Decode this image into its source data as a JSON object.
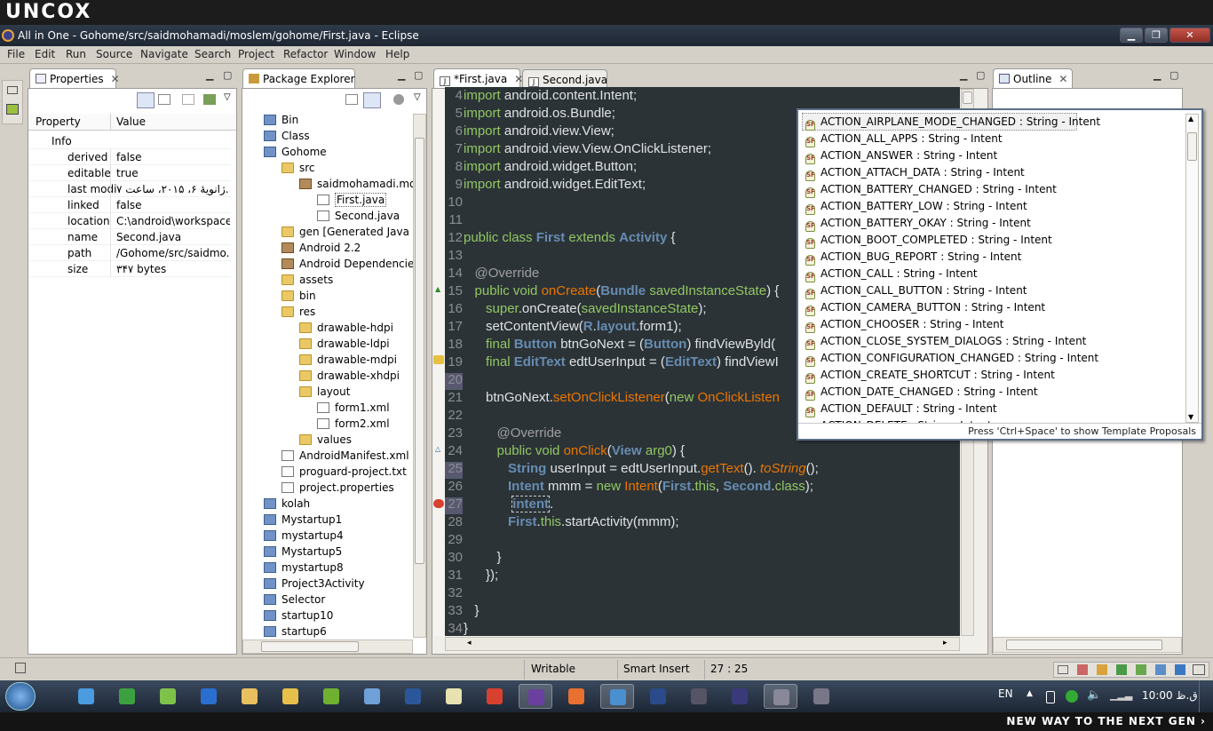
{
  "brand": "UNCOX",
  "window": {
    "title": "All in One - Gohome/src/saidmohamadi/moslem/gohome/First.java - Eclipse",
    "buttons": {
      "minimize": "▁",
      "maximize": "❐",
      "close": "✕"
    }
  },
  "menu": [
    "File",
    "Edit",
    "Run",
    "Source",
    "Navigate",
    "Search",
    "Project",
    "Refactor",
    "Window",
    "Help"
  ],
  "properties": {
    "tab": "Properties",
    "columns": [
      "Property",
      "Value"
    ],
    "group": "Info",
    "rows": [
      {
        "name": "derived",
        "value": "false"
      },
      {
        "name": "editable",
        "value": "true"
      },
      {
        "name": "last modi",
        "value": "ژانویهٔ ۶، ۲۰۱۵، ساعت ۷..."
      },
      {
        "name": "linked",
        "value": "false"
      },
      {
        "name": "location",
        "value": "C:\\android\\workspace..."
      },
      {
        "name": "name",
        "value": "Second.java"
      },
      {
        "name": "path",
        "value": "/Gohome/src/saidmo..."
      },
      {
        "name": "size",
        "value": "۳۴۷  bytes"
      }
    ]
  },
  "package_explorer": {
    "tab": "Package Explorer",
    "items": [
      {
        "label": "Bin",
        "icon": "project-icon",
        "indent": 0
      },
      {
        "label": "Class",
        "icon": "project-icon",
        "indent": 0
      },
      {
        "label": "Gohome",
        "icon": "android-project-icon",
        "indent": 0
      },
      {
        "label": "src",
        "icon": "source-folder-icon",
        "indent": 1
      },
      {
        "label": "saidmohamadi.mosl",
        "icon": "package-icon",
        "indent": 2
      },
      {
        "label": "First.java",
        "icon": "java-file-icon",
        "indent": 3,
        "selected": true
      },
      {
        "label": "Second.java",
        "icon": "java-file-icon",
        "indent": 3
      },
      {
        "label": "gen [Generated Java File",
        "icon": "source-folder-icon",
        "indent": 1
      },
      {
        "label": "Android 2.2",
        "icon": "library-icon",
        "indent": 1
      },
      {
        "label": "Android Dependencies",
        "icon": "library-icon",
        "indent": 1
      },
      {
        "label": "assets",
        "icon": "folder-icon",
        "indent": 1
      },
      {
        "label": "bin",
        "icon": "folder-icon",
        "indent": 1
      },
      {
        "label": "res",
        "icon": "folder-icon",
        "indent": 1
      },
      {
        "label": "drawable-hdpi",
        "icon": "folder-icon",
        "indent": 2
      },
      {
        "label": "drawable-ldpi",
        "icon": "folder-icon",
        "indent": 2
      },
      {
        "label": "drawable-mdpi",
        "icon": "folder-icon",
        "indent": 2
      },
      {
        "label": "drawable-xhdpi",
        "icon": "folder-icon",
        "indent": 2
      },
      {
        "label": "layout",
        "icon": "folder-icon",
        "indent": 2
      },
      {
        "label": "form1.xml",
        "icon": "xml-file-icon",
        "indent": 3
      },
      {
        "label": "form2.xml",
        "icon": "xml-file-icon",
        "indent": 3
      },
      {
        "label": "values",
        "icon": "folder-icon",
        "indent": 2
      },
      {
        "label": "AndroidManifest.xml",
        "icon": "xml-file-icon",
        "indent": 1
      },
      {
        "label": "proguard-project.txt",
        "icon": "text-file-icon",
        "indent": 1
      },
      {
        "label": "project.properties",
        "icon": "text-file-icon",
        "indent": 1
      },
      {
        "label": "kolah",
        "icon": "project-icon",
        "indent": 0
      },
      {
        "label": "Mystartup1",
        "icon": "project-icon",
        "indent": 0
      },
      {
        "label": "mystartup4",
        "icon": "project-icon",
        "indent": 0
      },
      {
        "label": "Mystartup5",
        "icon": "project-icon",
        "indent": 0
      },
      {
        "label": "mystartup8",
        "icon": "project-icon",
        "indent": 0
      },
      {
        "label": "Project3Activity",
        "icon": "project-icon",
        "indent": 0
      },
      {
        "label": "Selector",
        "icon": "project-icon",
        "indent": 0
      },
      {
        "label": "startup10",
        "icon": "project-icon",
        "indent": 0
      },
      {
        "label": "startup6",
        "icon": "project-icon",
        "indent": 0
      }
    ]
  },
  "editor": {
    "tabs": [
      {
        "label": "*First.java",
        "active": true
      },
      {
        "label": "Second.java",
        "active": false
      }
    ],
    "lines": [
      {
        "n": "4",
        "html": "<span class='kw'>import</span> android.content.Intent;"
      },
      {
        "n": "5",
        "html": "<span class='kw'>import</span> android.os.Bundle;"
      },
      {
        "n": "6",
        "html": "<span class='kw'>import</span> android.view.View;"
      },
      {
        "n": "7",
        "html": "<span class='kw'>import</span> android.view.View.OnClickListener;"
      },
      {
        "n": "8",
        "html": "<span class='kw'>import</span> android.widget.Button;"
      },
      {
        "n": "9",
        "html": "<span class='kw'>import</span> android.widget.EditText;"
      },
      {
        "n": "10",
        "html": ""
      },
      {
        "n": "11",
        "html": ""
      },
      {
        "n": "12",
        "html": "<span class='kw'>public class</span> <span class='typb'>First</span> <span class='kw'>extends</span> <span class='typb'>Activity</span> {"
      },
      {
        "n": "13",
        "html": ""
      },
      {
        "n": "14",
        "html": "   <span class='ann'>@Override</span>"
      },
      {
        "n": "15",
        "html": "   <span class='kw'>public void</span> <span class='str'>onCreate</span>(<span class='typb'>Bundle</span> <span class='kw'>savedInstanceState</span>) {"
      },
      {
        "n": "16",
        "html": "      <span class='kw'>super</span>.onCreate(<span class='kw'>savedInstanceState</span>);"
      },
      {
        "n": "17",
        "html": "      setContentView(<span class='typb'>R</span>.<span class='typb'>layout</span>.form1);"
      },
      {
        "n": "18",
        "html": "      <span class='kw'>final</span> <span class='typb'>Button</span> btnGoNext = (<span class='typb'>Button</span>) findViewByld("
      },
      {
        "n": "19",
        "html": "      <span class='kw'>final</span> <span class='typb'>EditText</span> edtUserInput = (<span class='typb'>EditText</span>) findViewI"
      },
      {
        "n": "20",
        "html": ""
      },
      {
        "n": "21",
        "html": "      btnGoNext.<span class='str'>setOnClickListener</span>(<span class='kw'>new</span> <span class='str'>OnClickListen</span>"
      },
      {
        "n": "22",
        "html": ""
      },
      {
        "n": "23",
        "html": "         <span class='ann'>@Override</span>"
      },
      {
        "n": "24",
        "html": "         <span class='kw'>public void</span> <span class='str'>onClick</span>(<span class='typb'>View</span> <span class='kw'>arg0</span>) {"
      },
      {
        "n": "25",
        "html": "            <span class='typb'>String</span> userInput = edtUserInput.<span class='str'>getText</span>(). <span class='it'>toString</span>();"
      },
      {
        "n": "26",
        "html": "            <span class='typb'>Intent</span> mmm = <span class='kw'>new</span> <span class='str'>Intent</span>(<span class='typb'>First</span>.<span class='kw'>this</span>, <span class='typb'>Second</span>.<span class='kw'>class</span>);"
      },
      {
        "n": "27",
        "html": "             <span class='typb' style='border:1px dashed #ccc'>intent</span>."
      },
      {
        "n": "28",
        "html": "            <span class='typb'>First</span>.<span class='kw'>this</span>.startActivity(mmm);"
      },
      {
        "n": "29",
        "html": ""
      },
      {
        "n": "30",
        "html": "         }"
      },
      {
        "n": "31",
        "html": "      });"
      },
      {
        "n": "32",
        "html": ""
      },
      {
        "n": "33",
        "html": "   }"
      },
      {
        "n": "34",
        "html": "}"
      }
    ]
  },
  "outline": {
    "tab": "Outline"
  },
  "content_assist": {
    "proposals": [
      "ACTION_AIRPLANE_MODE_CHANGED : String - Intent",
      "ACTION_ALL_APPS : String - Intent",
      "ACTION_ANSWER : String - Intent",
      "ACTION_ATTACH_DATA : String - Intent",
      "ACTION_BATTERY_CHANGED : String - Intent",
      "ACTION_BATTERY_LOW : String - Intent",
      "ACTION_BATTERY_OKAY : String - Intent",
      "ACTION_BOOT_COMPLETED : String - Intent",
      "ACTION_BUG_REPORT : String - Intent",
      "ACTION_CALL : String - Intent",
      "ACTION_CALL_BUTTON : String - Intent",
      "ACTION_CAMERA_BUTTON : String - Intent",
      "ACTION_CHOOSER : String - Intent",
      "ACTION_CLOSE_SYSTEM_DIALOGS : String - Intent",
      "ACTION_CONFIGURATION_CHANGED : String - Intent",
      "ACTION_CREATE_SHORTCUT : String - Intent",
      "ACTION_DATE_CHANGED : String - Intent",
      "ACTION_DEFAULT : String - Intent",
      "ACTION_DELETE : String - Intent"
    ],
    "hint": "Press 'Ctrl+Space' to show Template Proposals"
  },
  "status": {
    "writable": "Writable",
    "insert_mode": "Smart Insert",
    "position": "27 : 25"
  },
  "taskbar": {
    "lang": "EN",
    "clock": "10:00 ق.ظ",
    "apps": [
      "start",
      "ie",
      "green",
      "green2",
      "blue-round",
      "explorer",
      "yellow-folders",
      "green3",
      "cloud",
      "word",
      "notepad",
      "pdf",
      "vs",
      "firefox",
      "safari-like",
      "photoshop",
      "monitor",
      "eclipse",
      "gear",
      "calculator"
    ]
  },
  "bottom_slogan": "NEW WAY TO THE NEXT GEN ›"
}
